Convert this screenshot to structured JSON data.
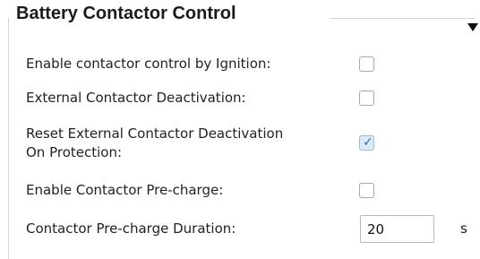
{
  "group": {
    "title": "Battery Contactor Control"
  },
  "rows": [
    {
      "label": "Enable contactor control by Ignition:",
      "checked": false
    },
    {
      "label": "External Contactor Deactivation:",
      "checked": false
    },
    {
      "label": "Reset External Contactor Deactivation On Protection:",
      "checked": true,
      "checkmark": "✓"
    },
    {
      "label": "Enable Contactor Pre-charge:",
      "checked": false
    }
  ],
  "duration": {
    "label": "Contactor Pre-charge Duration:",
    "value": "20",
    "unit": "s"
  },
  "colors": {
    "checked_fill": "#dce9f7",
    "checkmark": "#2b65b8"
  }
}
